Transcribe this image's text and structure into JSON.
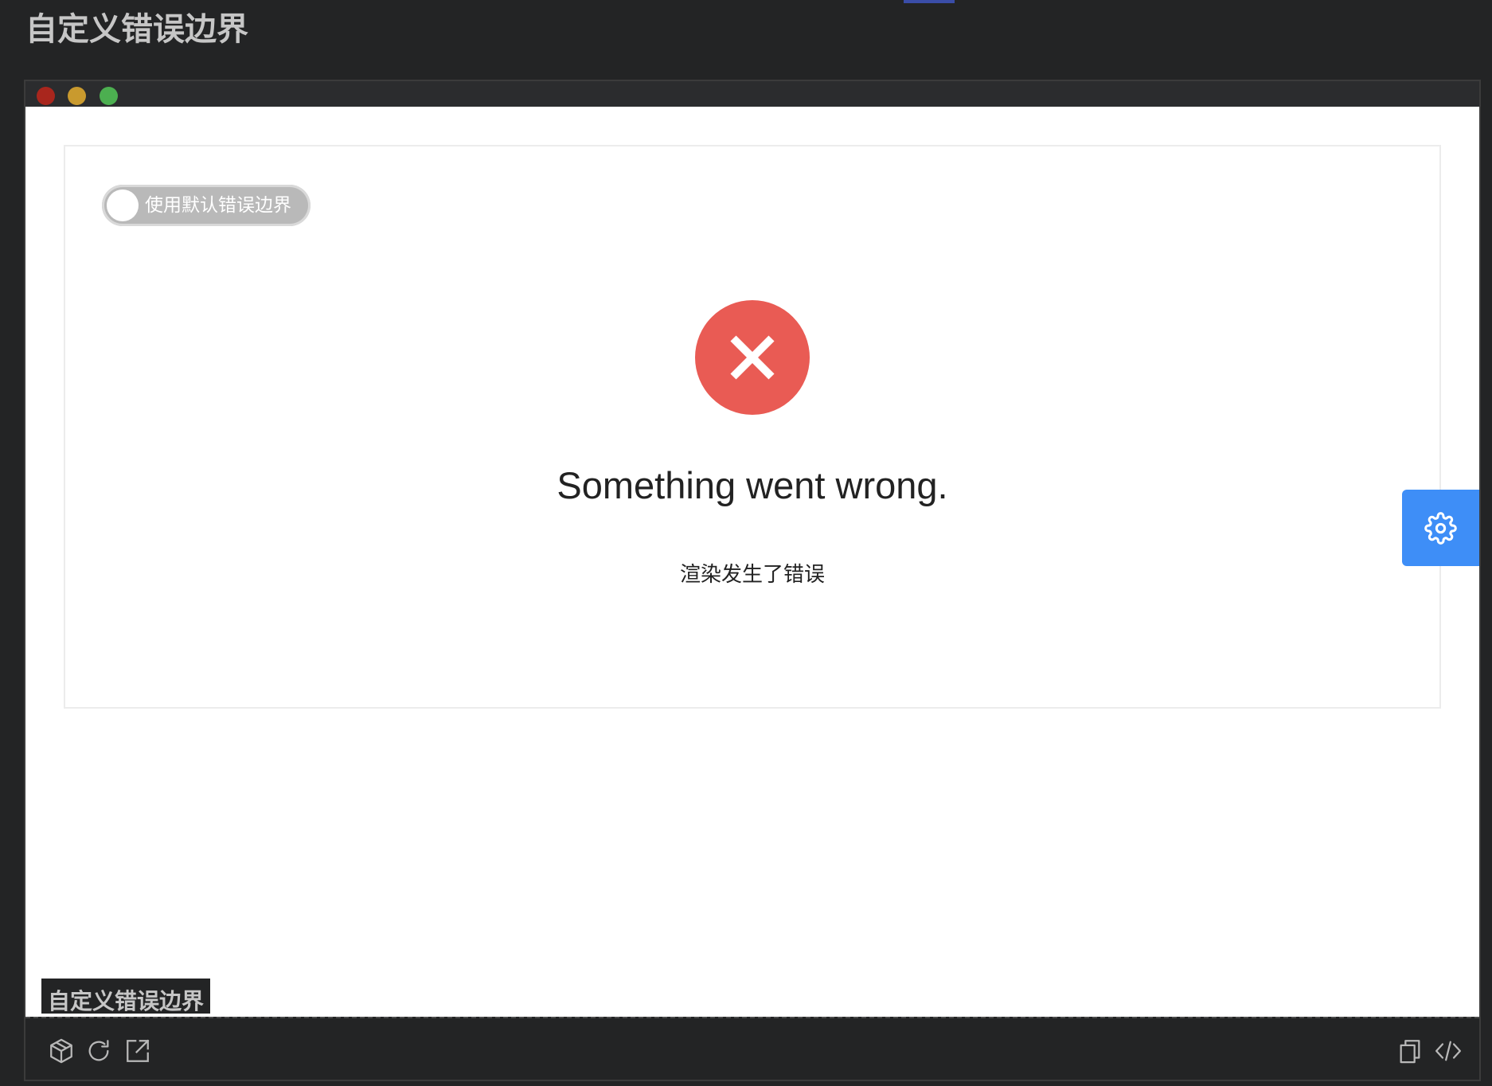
{
  "page": {
    "title": "自定义错误边界"
  },
  "demo": {
    "toggle_label": "使用默认错误边界",
    "toggle_on": false,
    "error_heading": "Something went wrong.",
    "error_detail": "渲染发生了错误",
    "caption": "自定义错误边界"
  },
  "icons": {
    "error": "x-icon",
    "settings": "gear-icon",
    "footer_left": [
      "cube-icon",
      "refresh-icon",
      "external-link-icon"
    ],
    "footer_right": [
      "copy-icon",
      "code-icon"
    ]
  },
  "colors": {
    "page_background": "#232425",
    "error_red": "#e95b54",
    "settings_blue": "#3e8ef7",
    "toggle_off": "#b9b9b9",
    "traffic_red": "#a9261d",
    "traffic_yellow": "#c99a2e",
    "traffic_green": "#4caf50"
  }
}
